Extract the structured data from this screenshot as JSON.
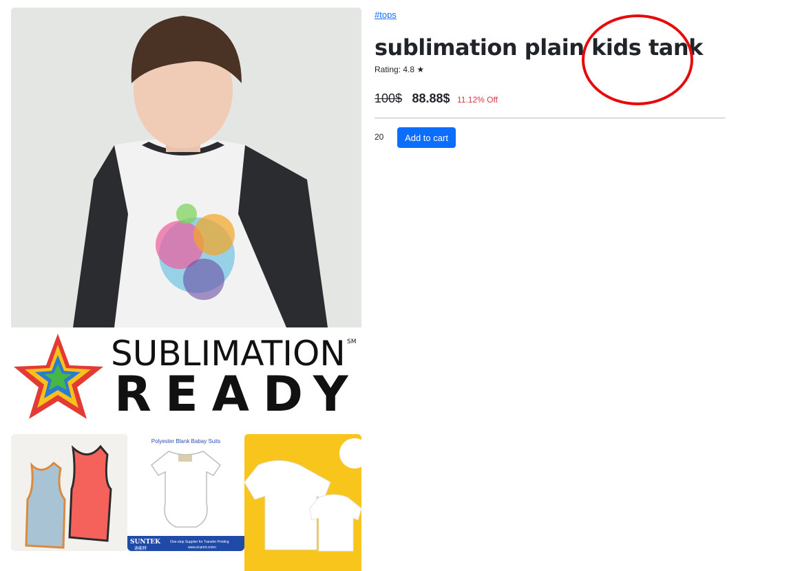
{
  "product": {
    "category": "#tops",
    "title": "sublimation plain kids tank",
    "rating": "Rating: 4.8 ★",
    "old_price": "100$",
    "new_price": "88.88$",
    "discount": "11.12% Off",
    "quantity": "20",
    "add_to_cart_label": "Add to cart"
  },
  "gallery": {
    "main_image_banner": {
      "line1": "SUBLIMATION",
      "trademark": "SM",
      "line2": "READY"
    },
    "thumb2": {
      "caption": "Polyester Blank Babay Suits",
      "brand": "SUNTEK",
      "brand_cn": "迪能特",
      "tagline": "One-stop Supplier for Transfer Printing",
      "url": "www.st-print.cn/en"
    }
  },
  "colors": {
    "link": "#0d6efd",
    "discount": "#dc3545",
    "button": "#0d6efd",
    "annotation": "#e8090a"
  }
}
